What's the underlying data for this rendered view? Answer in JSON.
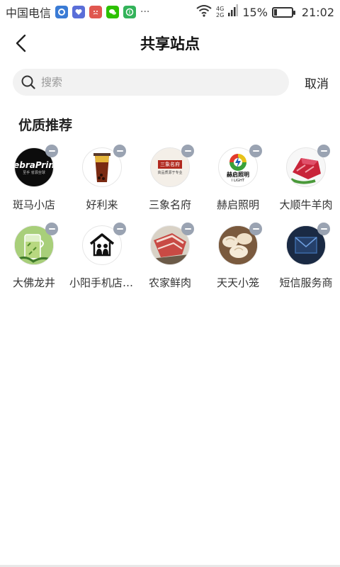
{
  "status_bar": {
    "carrier": "中国电信",
    "signal_labels": [
      "4G",
      "2G"
    ],
    "battery_percent": "15%",
    "battery_level": 0.15,
    "time": "21:02",
    "more": "···",
    "app_icons": [
      {
        "name": "browser-icon",
        "color": "#3a7bd5"
      },
      {
        "name": "health-icon",
        "color": "#5a6ed8"
      },
      {
        "name": "angry-face-icon",
        "color": "#e0574f"
      },
      {
        "name": "wechat-icon",
        "color": "#2dc100"
      },
      {
        "name": "money-icon",
        "color": "#33b35a"
      }
    ]
  },
  "header": {
    "title": "共享站点"
  },
  "search": {
    "placeholder": "搜索",
    "value": "",
    "cancel_label": "取消"
  },
  "section": {
    "title": "优质推荐"
  },
  "stores": [
    {
      "label": "斑马小店",
      "logo_text": "ebraPrin",
      "logo_subtext": "至手 省源全球",
      "bg": "#0c0c0c"
    },
    {
      "label": "好利来",
      "bg": "#b13a1a"
    },
    {
      "label": "三象名府",
      "logo_text": "三象名府",
      "logo_subtext": "高品质源于专业",
      "bg": "#f4efe8"
    },
    {
      "label": "赫启照明",
      "logo_text": "赫启照明",
      "logo_subtext": "I LIGHT",
      "bg": "#ffffff"
    },
    {
      "label": "大顺牛羊肉",
      "bg": "#c23040"
    },
    {
      "label": "大佛龙井",
      "bg": "#6fa24a"
    },
    {
      "label": "小阳手机店-...",
      "bg": "#ffffff"
    },
    {
      "label": "农家鲜肉",
      "bg": "#c8524c"
    },
    {
      "label": "天天小笼",
      "bg": "#8a6a4a"
    },
    {
      "label": "短信服务商",
      "bg": "#1d2e4a"
    }
  ]
}
